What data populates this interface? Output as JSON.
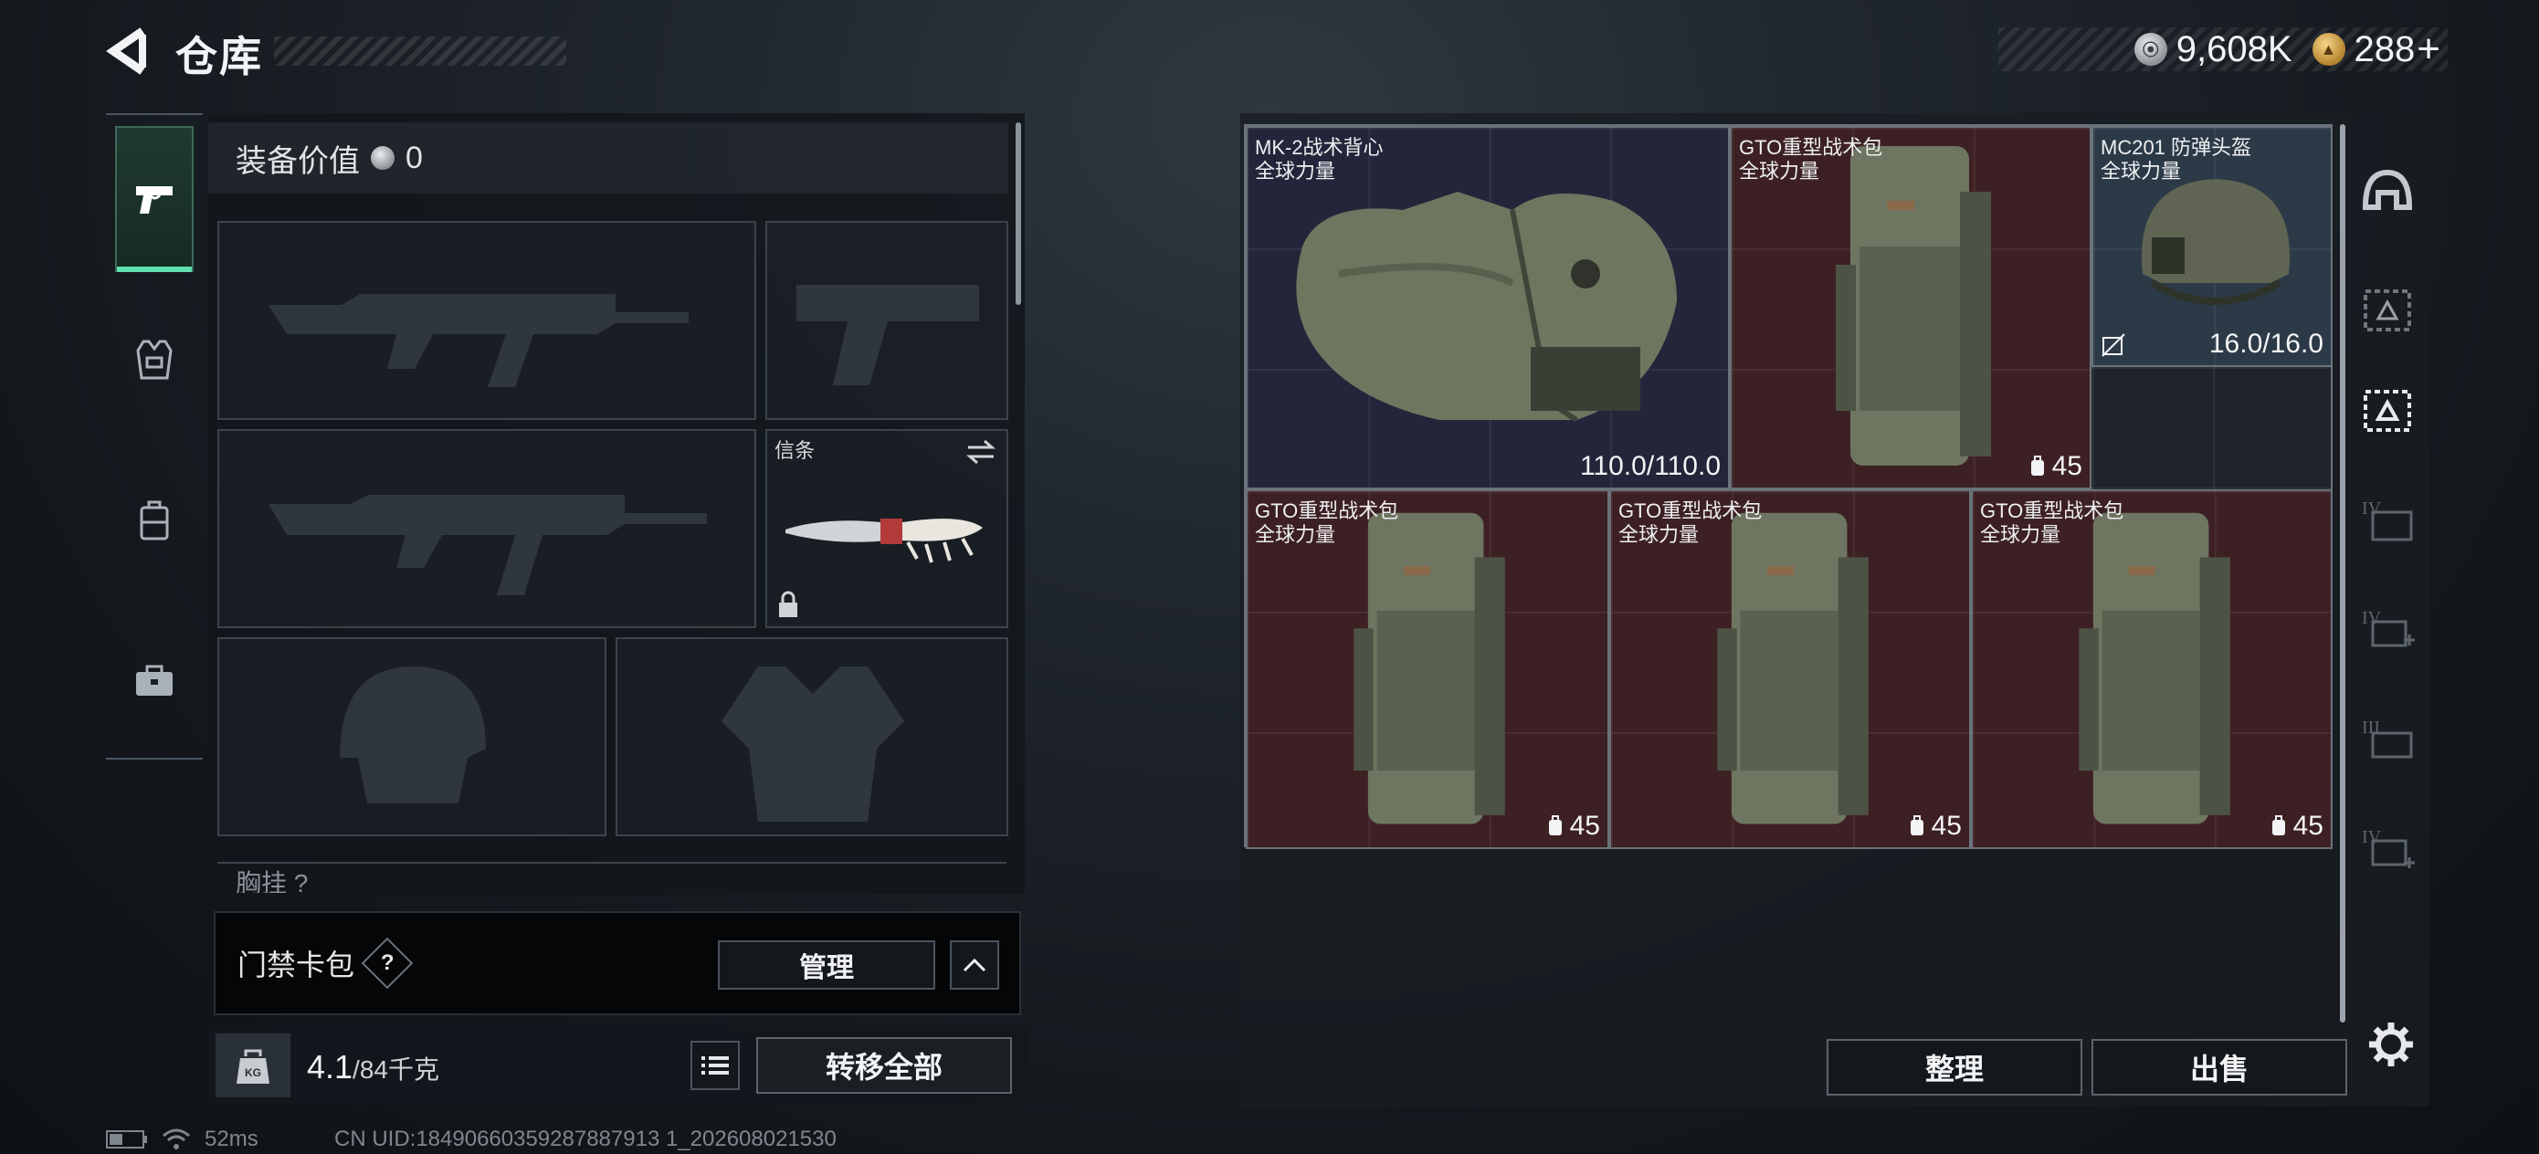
{
  "header": {
    "title": "仓库",
    "currency_silver": "9,608K",
    "currency_gold": "288",
    "plus_label": "+"
  },
  "loadout": {
    "value_label": "装备价值",
    "value": "0",
    "melee_slot_label": "信条",
    "chest_label": "胸挂",
    "chest_suffix": "?"
  },
  "keycard": {
    "label": "门禁卡包",
    "help": "?",
    "manage_label": "管理"
  },
  "capacity": {
    "kg_label": "KG",
    "current": "4.1",
    "max": "/84千克",
    "transfer_all_label": "转移全部"
  },
  "status": {
    "ping": "52ms",
    "uid": "CN UID:18490660359287887913 1_202608021530"
  },
  "stash": {
    "items": [
      {
        "name": "MK-2战术背心",
        "sub": "全球力量",
        "value": "110.0/110.0"
      },
      {
        "name": "GTO重型战术包",
        "sub": "全球力量",
        "value": "45"
      },
      {
        "name": "MC201 防弹头盔",
        "sub": "全球力量",
        "value": "16.0/16.0"
      },
      {
        "name": "GTO重型战术包",
        "sub": "全球力量",
        "value": "45"
      },
      {
        "name": "GTO重型战术包",
        "sub": "全球力量",
        "value": "45"
      },
      {
        "name": "GTO重型战术包",
        "sub": "全球力量",
        "value": "45"
      }
    ],
    "tidy_label": "整理",
    "sell_label": "出售"
  },
  "filters": [
    "helmet-icon",
    "armor-filter-icon",
    "armor-active-icon",
    "tier-iv-icon",
    "tier-iv-plus-icon",
    "tier-iii-icon",
    "tier-iv-add-icon"
  ],
  "colors": {
    "accent_green": "#5fe0ae",
    "item_red": "#3d2024",
    "item_blue": "#23263a",
    "item_steel": "#2c3a48"
  }
}
